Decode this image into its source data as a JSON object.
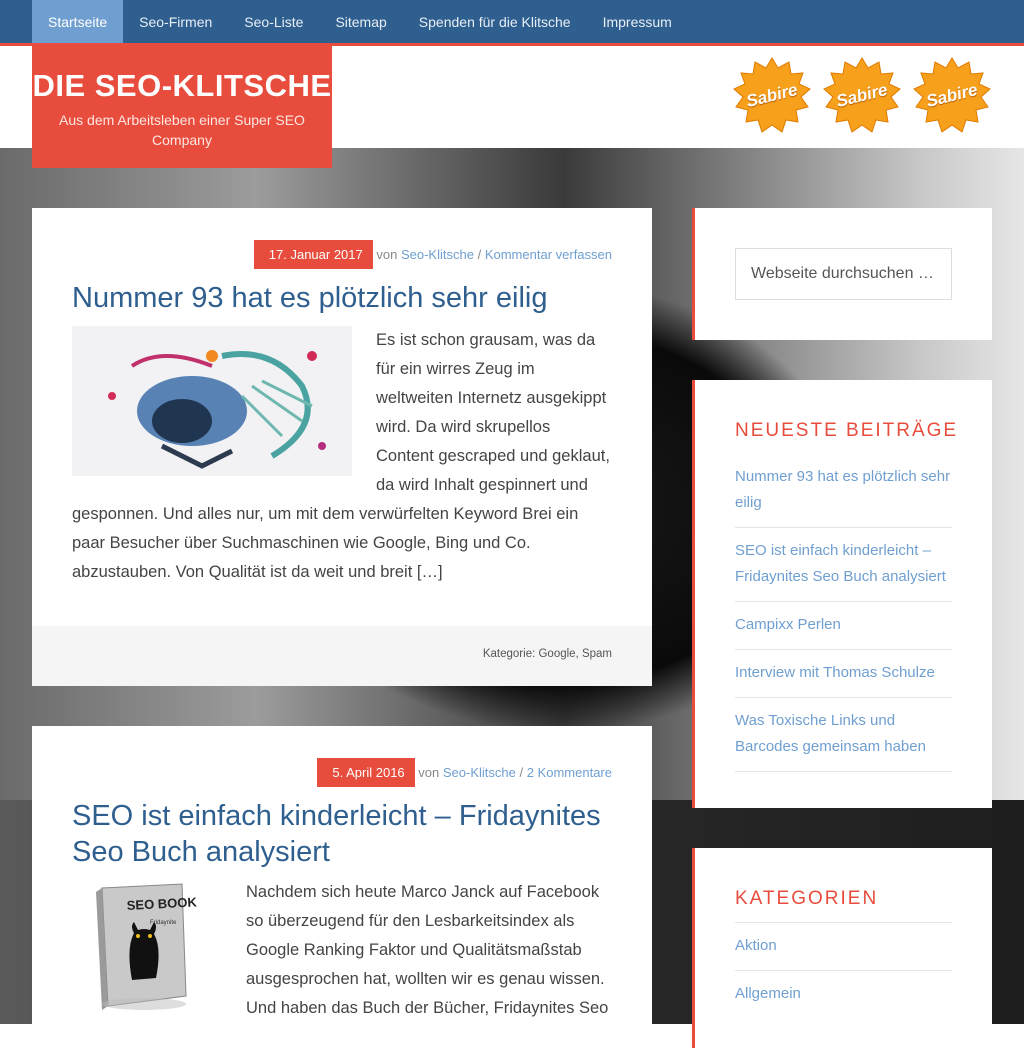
{
  "nav": {
    "items": [
      {
        "label": "Startseite",
        "active": true
      },
      {
        "label": "Seo-Firmen"
      },
      {
        "label": "Seo-Liste"
      },
      {
        "label": "Sitemap"
      },
      {
        "label": "Spenden für die Klitsche"
      },
      {
        "label": "Impressum"
      }
    ]
  },
  "site": {
    "title": "DIE SEO-KLITSCHE",
    "tagline": "Aus dem Arbeitsleben einer Super SEO Company"
  },
  "badges": [
    {
      "label": "Sabire"
    },
    {
      "label": "Sabire"
    },
    {
      "label": "Sabire"
    }
  ],
  "posts": [
    {
      "date": "17. Januar 2017",
      "by": "von",
      "author": "Seo-Klitsche",
      "separator": "/",
      "comments": "Kommentar verfassen",
      "title": "Nummer 93 hat es plötzlich sehr eilig",
      "excerpt": "Es ist schon grausam, was da für ein wirres Zeug im weltweiten Internetz ausgekippt wird. Da wird skrupellos Content gescraped und geklaut, da wird Inhalt gespinnert und gesponnen. Und alles nur, um mit dem verwürfelten Keyword Brei ein paar Besucher über Suchmaschinen wie Google, Bing und Co. abzustauben. Von Qualität ist da weit und breit […]",
      "categories": "Kategorie: Google, Spam"
    },
    {
      "date": "5. April 2016",
      "by": "von",
      "author": "Seo-Klitsche",
      "separator": "/",
      "comments": "2 Kommentare",
      "title": "SEO ist einfach kinderleicht – Fridaynites Seo Buch analysiert",
      "excerpt": "Nachdem sich heute Marco Janck auf Facebook so überzeugend für den Lesbarkeitsindex als Google Ranking Faktor und Qualitätsmaßstab ausgesprochen hat, wollten wir es genau wissen. Und haben das Buch der Bücher, Fridaynites Seo",
      "book_cover_title": "SEO BOOK",
      "book_cover_sub": "Fridaynite"
    }
  ],
  "sidebar": {
    "search_placeholder": "Webseite durchsuchen …",
    "recent_title": "NEUESTE BEITRÄGE",
    "recent": [
      "Nummer 93 hat es plötzlich sehr eilig",
      "SEO ist einfach kinderleicht – Fridaynites Seo Buch analysiert",
      "Campixx Perlen",
      "Interview mit Thomas Schulze",
      "Was Toxische Links und Barcodes gemeinsam haben"
    ],
    "cats_title": "KATEGORIEN",
    "cats": [
      "Aktion",
      "Allgemein"
    ]
  },
  "colors": {
    "accent": "#e74c3c",
    "nav_bg": "#2f5f8f",
    "link": "#6f9fd0",
    "badge": "#f7a01c"
  }
}
